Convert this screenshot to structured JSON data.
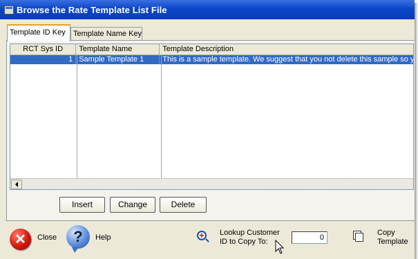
{
  "window": {
    "title": "Browse the Rate Template List File"
  },
  "tabs": [
    {
      "label": "Template ID Key",
      "active": true
    },
    {
      "label": "Template Name Key",
      "active": false
    }
  ],
  "grid": {
    "columns": [
      "RCT Sys ID",
      "Template Name",
      "Template Description"
    ],
    "rows": [
      {
        "id": "1",
        "name": "Sample Template 1",
        "description": "This is a sample template. We suggest that you not delete this sample so you"
      }
    ]
  },
  "actions": {
    "insert": "Insert",
    "change": "Change",
    "delete": "Delete"
  },
  "footer": {
    "close": "Close",
    "help": "Help",
    "lookup_line1": "Lookup Customer",
    "lookup_line2": "ID to Copy To:",
    "lookup_value": "0",
    "copy_line1": "Copy",
    "copy_line2": "Template"
  },
  "icons": [
    "window-icon",
    "close-icon",
    "help-icon",
    "magnify-icon",
    "copy-icon",
    "scroll-left-icon",
    "mouse-cursor-icon"
  ],
  "colors": {
    "titlebar": "#0a46c8",
    "selection": "#316ac5",
    "close_icon": "#d4170d",
    "help_icon": "#5d8edc"
  }
}
